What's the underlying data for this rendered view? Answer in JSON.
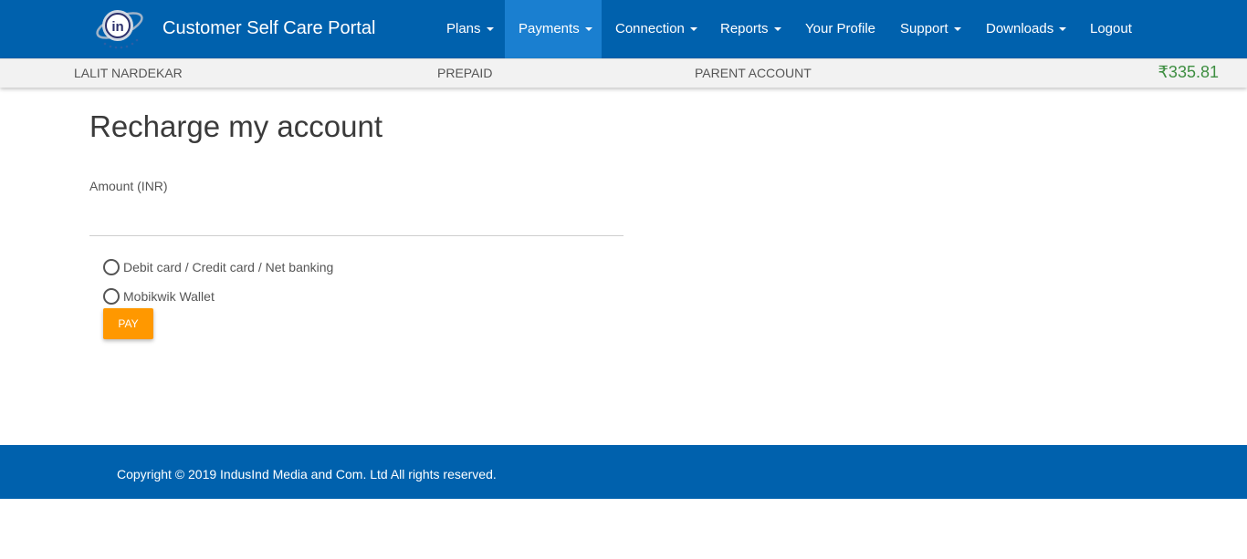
{
  "app": {
    "title": "Customer Self Care Portal",
    "logo_icon": "in-globe-logo",
    "logo_text": "in"
  },
  "nav": {
    "items": [
      {
        "label": "Plans",
        "dropdown": true
      },
      {
        "label": "Payments",
        "dropdown": true,
        "active": true
      },
      {
        "label": "Connection",
        "dropdown": true
      },
      {
        "label": "Reports",
        "dropdown": true
      },
      {
        "label": "Your Profile",
        "dropdown": false
      },
      {
        "label": "Support",
        "dropdown": true
      },
      {
        "label": "Downloads",
        "dropdown": true
      },
      {
        "label": "Logout",
        "dropdown": false
      }
    ]
  },
  "account": {
    "name": "LALIT NARDEKAR",
    "type": "PREPAID",
    "role": "PARENT ACCOUNT",
    "balance": "₹335.81"
  },
  "main": {
    "title": "Recharge my account",
    "amount_label": "Amount (INR)",
    "amount_value": "",
    "payment_options": [
      {
        "label": "Debit card / Credit card / Net banking",
        "selected": false
      },
      {
        "label": "Mobikwik Wallet",
        "selected": false
      }
    ],
    "pay_label": "PAY"
  },
  "footer": {
    "copyright": "Copyright © 2019 IndusInd Media and Com. Ltd All rights reserved."
  },
  "colors": {
    "primary": "#0061ad",
    "nav_active": "#1a7fd0",
    "pay_button": "#ff9800",
    "balance": "#3e8e41"
  }
}
